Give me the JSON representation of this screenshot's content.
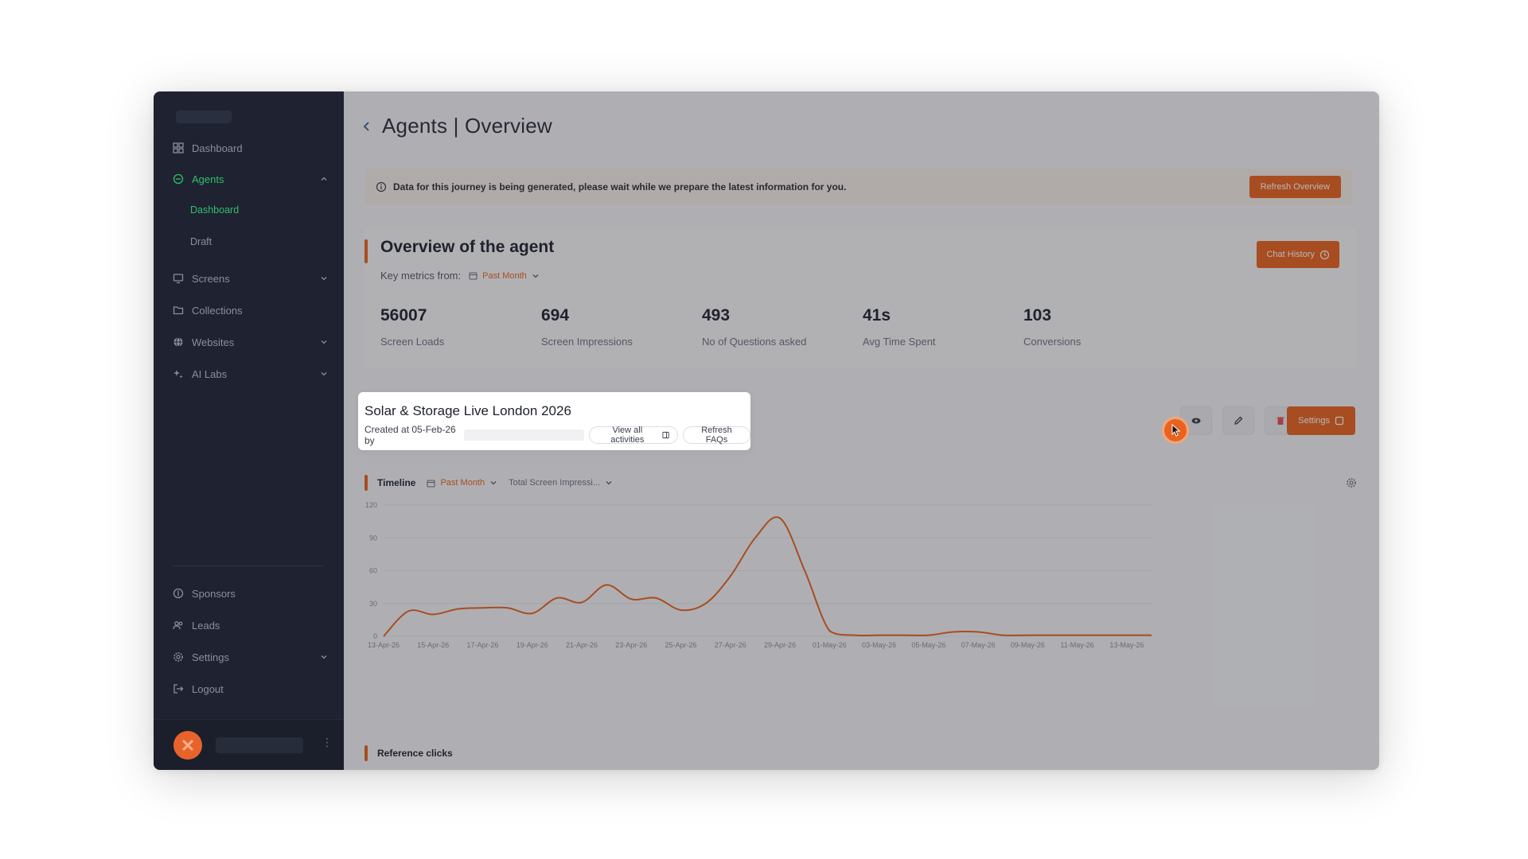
{
  "sidebar": {
    "items": [
      {
        "label": "Dashboard",
        "icon": "grid-icon"
      },
      {
        "label": "Agents",
        "icon": "agent-icon",
        "active": true
      },
      {
        "label": "Screens",
        "icon": "monitor-icon"
      },
      {
        "label": "Collections",
        "icon": "folder-icon"
      },
      {
        "label": "Websites",
        "icon": "globe-icon"
      },
      {
        "label": "AI Labs",
        "icon": "sparkle-icon"
      },
      {
        "label": "Sponsors",
        "icon": "sponsor-icon"
      },
      {
        "label": "Leads",
        "icon": "users-icon"
      },
      {
        "label": "Settings",
        "icon": "gear-icon"
      },
      {
        "label": "Logout",
        "icon": "logout-icon"
      }
    ],
    "subitems": [
      {
        "label": "Dashboard",
        "active": true
      },
      {
        "label": "Draft"
      }
    ]
  },
  "header": {
    "title": "Agents | Overview"
  },
  "banner": {
    "text": "Data for this journey is being generated, please wait while we prepare the latest information for you.",
    "button": "Refresh Overview"
  },
  "overview": {
    "title": "Overview of the agent",
    "metrics_label": "Key metrics from:",
    "period": "Past Month",
    "chat_button": "Chat History",
    "metrics": [
      {
        "value": "56007",
        "label": "Screen Loads"
      },
      {
        "value": "694",
        "label": "Screen Impressions"
      },
      {
        "value": "493",
        "label": "No of Questions asked"
      },
      {
        "value": "41s",
        "label": "Avg Time Spent"
      },
      {
        "value": "103",
        "label": "Conversions"
      }
    ]
  },
  "event": {
    "title": "Solar & Storage Live London 2026",
    "created": "Created at 05-Feb-26 by",
    "view_all": "View all activities",
    "refresh_faqs": "Refresh FAQs",
    "settings": "Settings"
  },
  "timeline": {
    "title": "Timeline",
    "period": "Past Month",
    "metric": "Total Screen Impressi..."
  },
  "reference": {
    "title": "Reference clicks"
  },
  "colors": {
    "accent": "#e8631f",
    "active_nav": "#2fbf6b",
    "sidebar_bg": "#1f2331"
  },
  "chart_data": {
    "type": "line",
    "x": [
      "13-Apr-26",
      "14-Apr-26",
      "15-Apr-26",
      "16-Apr-26",
      "17-Apr-26",
      "18-Apr-26",
      "19-Apr-26",
      "20-Apr-26",
      "21-Apr-26",
      "22-Apr-26",
      "23-Apr-26",
      "24-Apr-26",
      "25-Apr-26",
      "26-Apr-26",
      "27-Apr-26",
      "28-Apr-26",
      "29-Apr-26",
      "30-Apr-26",
      "01-May-26",
      "02-May-26",
      "03-May-26",
      "04-May-26",
      "05-May-26",
      "06-May-26",
      "07-May-26",
      "08-May-26",
      "09-May-26",
      "10-May-26",
      "11-May-26",
      "12-May-26",
      "13-May-26",
      "14-May-26"
    ],
    "xticks": [
      "13-Apr-26",
      "15-Apr-26",
      "17-Apr-26",
      "19-Apr-26",
      "21-Apr-26",
      "23-Apr-26",
      "25-Apr-26",
      "27-Apr-26",
      "29-Apr-26",
      "01-May-26",
      "03-May-26",
      "05-May-26",
      "07-May-26",
      "09-May-26",
      "11-May-26",
      "13-May-26"
    ],
    "values": [
      0,
      23,
      20,
      25,
      26,
      26,
      21,
      35,
      31,
      47,
      34,
      35,
      24,
      30,
      55,
      90,
      108,
      60,
      5,
      1,
      1,
      1,
      1,
      4,
      4,
      1,
      1,
      1,
      1,
      1,
      1,
      1
    ],
    "ylim": [
      0,
      120
    ],
    "yticks": [
      0,
      30,
      60,
      90,
      120
    ],
    "grid": true
  }
}
